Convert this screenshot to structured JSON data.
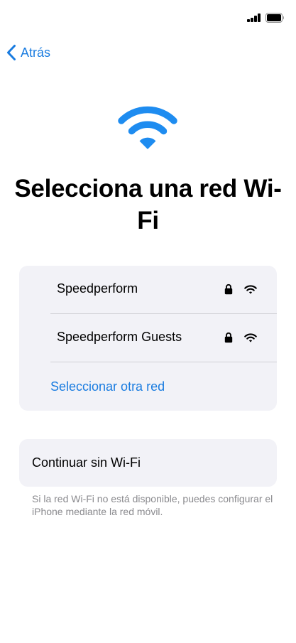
{
  "status_bar": {
    "signal_icon": "cellular-signal-icon",
    "battery_icon": "battery-icon"
  },
  "nav": {
    "back_label": "Atrás",
    "back_icon": "chevron-left-icon"
  },
  "hero": {
    "icon": "wifi-icon",
    "title": "Selecciona una red Wi-Fi"
  },
  "networks": [
    {
      "name": "Speedperform",
      "secured": true,
      "lock_icon": "lock-icon",
      "signal_icon": "wifi-signal-icon"
    },
    {
      "name": "Speedperform Guests",
      "secured": true,
      "lock_icon": "lock-icon",
      "signal_icon": "wifi-signal-icon"
    }
  ],
  "other_network_label": "Seleccionar otra red",
  "continue_without_wifi_label": "Continuar sin Wi-Fi",
  "footnote": "Si la red Wi-Fi no está disponible, puedes configurar el iPhone mediante la red móvil.",
  "colors": {
    "accent": "#1a7ce0",
    "hero_icon": "#1e8cf0",
    "card_bg": "#f2f2f7",
    "secondary_text": "#8a8a8e"
  }
}
